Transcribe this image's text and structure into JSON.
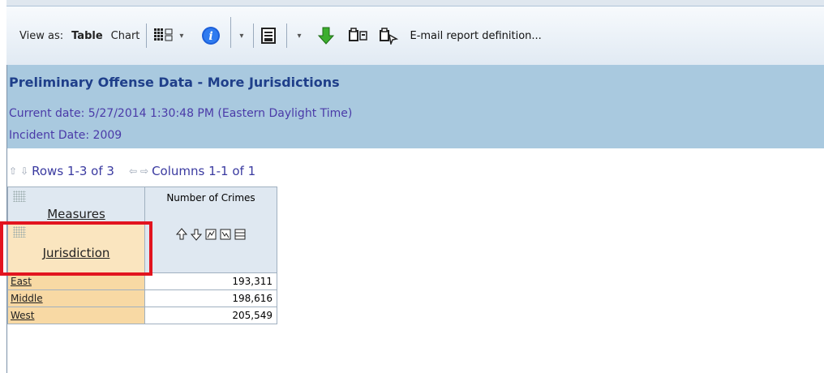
{
  "toolbar": {
    "view_as_label": "View as:",
    "view_options": [
      "Table",
      "Chart"
    ],
    "active_view": "Table",
    "email_link": "E-mail report definition..."
  },
  "report": {
    "title": "Preliminary Offense Data - More Jurisdictions",
    "current_date": "Current date: 5/27/2014 1:30:48 PM (Eastern Daylight Time)",
    "incident_date": "Incident Date: 2009"
  },
  "navigation": {
    "rows_label": "Rows 1-3 of 3",
    "columns_label": "Columns 1-1 of 1"
  },
  "grid": {
    "measures_label": "Measures",
    "dimension_label": "Jurisdiction",
    "column_header": "Number of Crimes",
    "rows": [
      {
        "label": "East",
        "value": "193,311"
      },
      {
        "label": "Middle",
        "value": "198,616"
      },
      {
        "label": "West",
        "value": "205,549"
      }
    ]
  },
  "colors": {
    "header_band": "#a9c9df",
    "title": "#1f3f8a",
    "row_header": "#f8d9a4",
    "highlight": "#e2141f"
  }
}
